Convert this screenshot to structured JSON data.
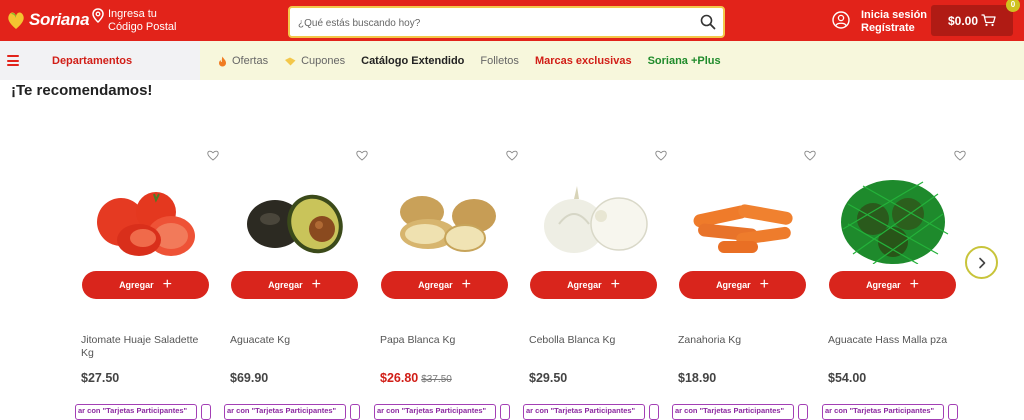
{
  "brand": {
    "name": "Soriana",
    "color": "#e2231a",
    "accent": "#f3c74a"
  },
  "location": {
    "line1": "Ingresa tu",
    "line2": "Código Postal"
  },
  "search": {
    "placeholder": "¿Qué estás buscando hoy?"
  },
  "account": {
    "line1": "Inicia sesión",
    "line2": "Regístrate"
  },
  "cart": {
    "total": "$0.00",
    "count": "0"
  },
  "nav": {
    "departments_label": "Departamentos",
    "links": [
      {
        "label": "Ofertas",
        "icon": "fire-icon",
        "style": "gray"
      },
      {
        "label": "Cupones",
        "icon": "coupon-icon",
        "style": "gray"
      },
      {
        "label": "Catálogo Extendido",
        "style": "dark"
      },
      {
        "label": "Folletos",
        "style": "gray"
      },
      {
        "label": "Marcas exclusivas",
        "style": "red"
      },
      {
        "label": "Soriana +Plus",
        "style": "green"
      }
    ]
  },
  "section": {
    "title": "¡Te recomendamos!"
  },
  "products": [
    {
      "name": "Jitomate Huaje Saladette Kg",
      "price": "$27.50",
      "original_price": "",
      "add_label": "Agregar",
      "promo": "ar con \"Tarjetas Participantes\"",
      "image": "tomato-image"
    },
    {
      "name": "Aguacate Kg",
      "price": "$69.90",
      "original_price": "",
      "add_label": "Agregar",
      "promo": "ar con \"Tarjetas Participantes\"",
      "image": "avocado-image"
    },
    {
      "name": "Papa Blanca Kg",
      "price": "$26.80",
      "original_price": "$37.50",
      "add_label": "Agregar",
      "promo": "ar con \"Tarjetas Participantes\"",
      "image": "potato-image"
    },
    {
      "name": "Cebolla Blanca Kg",
      "price": "$29.50",
      "original_price": "",
      "add_label": "Agregar",
      "promo": "ar con \"Tarjetas Participantes\"",
      "image": "onion-image"
    },
    {
      "name": "Zanahoria Kg",
      "price": "$18.90",
      "original_price": "",
      "add_label": "Agregar",
      "promo": "ar con \"Tarjetas Participantes\"",
      "image": "carrot-image"
    },
    {
      "name": "Aguacate Hass Malla pza",
      "price": "$54.00",
      "original_price": "",
      "add_label": "Agregar",
      "promo": "ar con \"Tarjetas Participantes\"",
      "image": "avocado-mesh-image"
    }
  ]
}
